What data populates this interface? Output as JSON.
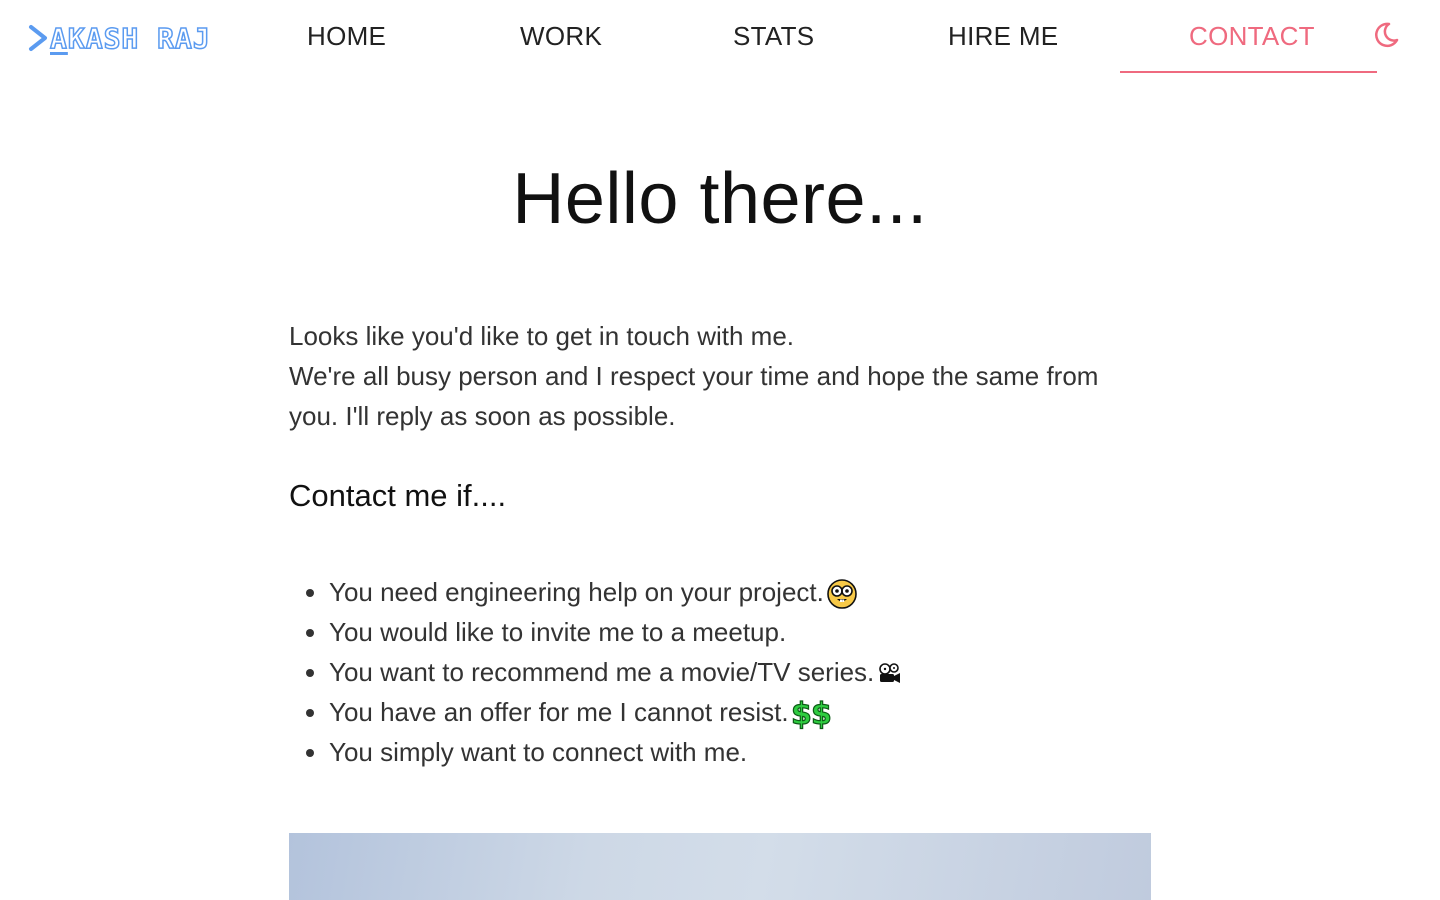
{
  "header": {
    "logo": {
      "first_letter": "A",
      "rest": "KASH RAJ",
      "color": "#5b9bf0"
    },
    "nav": {
      "home": "HOME",
      "work": "WORK",
      "stats": "STATS",
      "hire": "HIRE ME",
      "contact": "CONTACT"
    },
    "active_nav": "contact",
    "accent_color": "#ef6a7f",
    "theme_toggle_icon": "moon-icon"
  },
  "main": {
    "title": "Hello there...",
    "intro_lines": [
      "Looks like you'd like to get in touch with me.",
      "We're all busy person and I respect your time and hope the same from you. I'll reply as soon as possible."
    ],
    "subheading": "Contact me if....",
    "reasons": [
      {
        "text": "You need engineering help on your project.",
        "icon": "nerd-face-icon"
      },
      {
        "text": "You would like to invite me to a meetup.",
        "icon": ""
      },
      {
        "text": "You want to recommend me a movie/TV series.",
        "icon": "film-projector-icon"
      },
      {
        "text": "You have an offer for me I cannot resist.",
        "icon": "dollar-signs-icon"
      },
      {
        "text": "You simply want to connect with me.",
        "icon": ""
      }
    ]
  }
}
